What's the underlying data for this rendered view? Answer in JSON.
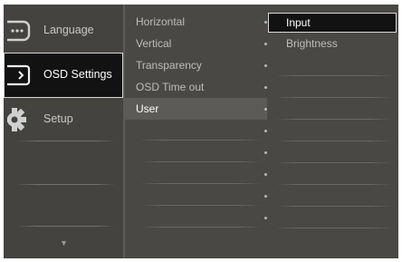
{
  "main_menu": {
    "items": [
      {
        "label": "Language",
        "icon": "speech-bubble-icon",
        "selected": false
      },
      {
        "label": "OSD Settings",
        "icon": "osd-screen-icon",
        "selected": true
      },
      {
        "label": "Setup",
        "icon": "gear-icon",
        "selected": false
      }
    ],
    "scroll_indicator": "▼"
  },
  "sub_menu": {
    "items": [
      {
        "label": "Horizontal",
        "selected": false
      },
      {
        "label": "Vertical",
        "selected": false
      },
      {
        "label": "Transparency",
        "selected": false
      },
      {
        "label": "OSD Time out",
        "selected": false
      },
      {
        "label": "User",
        "selected": true
      }
    ]
  },
  "options": {
    "items": [
      {
        "label": "Input",
        "selected": true
      },
      {
        "label": "Brightness",
        "selected": false
      }
    ]
  },
  "colors": {
    "panel": "#4a4845",
    "highlight": "#121212",
    "highlight_border": "#d8d8d8",
    "submenu_selected": "#5d5b57",
    "text": "#c8c8c8"
  }
}
